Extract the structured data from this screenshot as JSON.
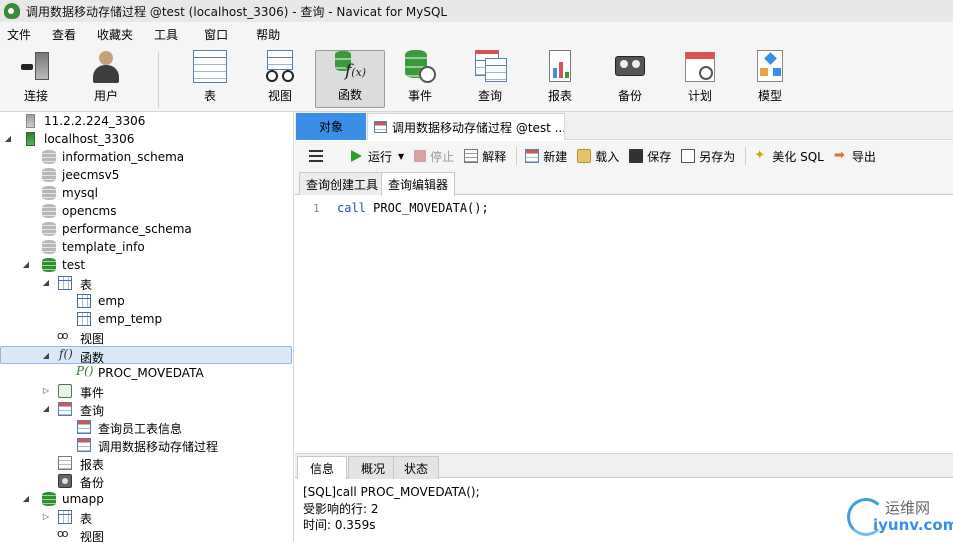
{
  "window": {
    "title": "调用数据移动存储过程 @test (localhost_3306) - 查询 - Navicat for MySQL"
  },
  "menu": [
    "文件",
    "查看",
    "收藏夹",
    "工具",
    "窗口",
    "帮助"
  ],
  "toolbar": {
    "items": [
      {
        "label": "连接",
        "icon": "plug-icon"
      },
      {
        "label": "用户",
        "icon": "user-icon"
      },
      {
        "label": "表",
        "icon": "table-icon"
      },
      {
        "label": "视图",
        "icon": "glasses-icon"
      },
      {
        "label": "函数",
        "icon": "function-icon",
        "active": true
      },
      {
        "label": "事件",
        "icon": "event-clock-icon"
      },
      {
        "label": "查询",
        "icon": "query-icon"
      },
      {
        "label": "报表",
        "icon": "report-icon"
      },
      {
        "label": "备份",
        "icon": "backup-icon"
      },
      {
        "label": "计划",
        "icon": "calendar-icon"
      },
      {
        "label": "模型",
        "icon": "model-icon"
      }
    ]
  },
  "tree": [
    {
      "label": "11.2.2.224_3306",
      "icon": "server-gray"
    },
    {
      "label": "localhost_3306",
      "icon": "server-green"
    },
    {
      "label": "information_schema",
      "icon": "db-gray"
    },
    {
      "label": "jeecmsv5",
      "icon": "db-gray"
    },
    {
      "label": "mysql",
      "icon": "db-gray"
    },
    {
      "label": "opencms",
      "icon": "db-gray"
    },
    {
      "label": "performance_schema",
      "icon": "db-gray"
    },
    {
      "label": "template_info",
      "icon": "db-gray"
    },
    {
      "label": "test",
      "icon": "db-green"
    },
    {
      "label": "表",
      "icon": "table"
    },
    {
      "label": "emp",
      "icon": "table"
    },
    {
      "label": "emp_temp",
      "icon": "table"
    },
    {
      "label": "视图",
      "icon": "view"
    },
    {
      "label": "函数",
      "icon": "function"
    },
    {
      "label": "PROC_MOVEDATA",
      "icon": "procedure"
    },
    {
      "label": "事件",
      "icon": "event"
    },
    {
      "label": "查询",
      "icon": "query"
    },
    {
      "label": "查询员工表信息",
      "icon": "query"
    },
    {
      "label": "调用数据移动存储过程",
      "icon": "query"
    },
    {
      "label": "报表",
      "icon": "report"
    },
    {
      "label": "备份",
      "icon": "backup"
    },
    {
      "label": "umapp",
      "icon": "db-green"
    },
    {
      "label": "表",
      "icon": "table"
    },
    {
      "label": "视图",
      "icon": "view"
    }
  ],
  "tabs": {
    "objects": "对象",
    "query": "调用数据移动存储过程 @test ..."
  },
  "query_toolbar": {
    "run": "运行",
    "stop": "停止",
    "explain": "解释",
    "new": "新建",
    "load": "载入",
    "save": "保存",
    "save_as": "另存为",
    "beautify": "美化 SQL",
    "export": "导出"
  },
  "subtabs": [
    "查询创建工具",
    "查询编辑器"
  ],
  "editor": {
    "line_number": "1",
    "keyword": "call",
    "rest": " PROC_MOVEDATA();"
  },
  "bottom_tabs": [
    "信息",
    "概况",
    "状态"
  ],
  "output": {
    "line1": "[SQL]call PROC_MOVEDATA();",
    "line2": "受影响的行: 2",
    "line3": "时间: 0.359s"
  },
  "watermark": {
    "line1": "运维网",
    "line2": "iyunv.com"
  },
  "colors": {
    "accent": "#3a8ee6",
    "selection": "#dbe8f7",
    "keyword": "#1f4bd1"
  }
}
